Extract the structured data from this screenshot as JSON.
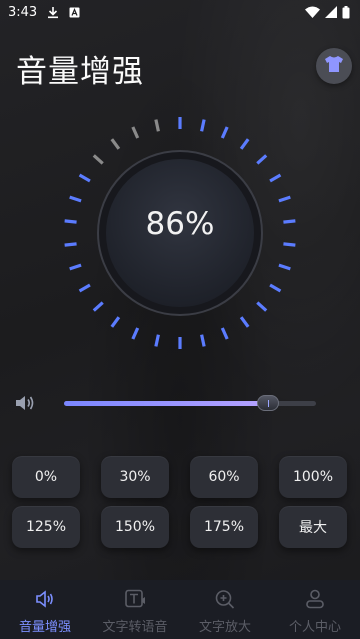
{
  "status_bar": {
    "time": "3:43"
  },
  "header": {
    "title": "音量增强"
  },
  "dial": {
    "percent_text": "86%",
    "level": 0.86,
    "tick_count": 30,
    "accent": "#5b7cff",
    "inactive_tick": "#8a8a8a"
  },
  "volume": {
    "level": 0.81,
    "icon": "speaker-icon"
  },
  "presets": [
    "0%",
    "30%",
    "60%",
    "100%",
    "125%",
    "150%",
    "175%",
    "最大"
  ],
  "nav": {
    "items": [
      {
        "label": "音量增强",
        "icon": "speaker-boost-icon",
        "active": true
      },
      {
        "label": "文字转语音",
        "icon": "text-to-speech-icon",
        "active": false
      },
      {
        "label": "文字放大",
        "icon": "zoom-icon",
        "active": false
      },
      {
        "label": "个人中心",
        "icon": "profile-icon",
        "active": false
      }
    ]
  },
  "colors": {
    "accent": "#7c8fff",
    "background": "#1f1f21",
    "button": "#2d2f36"
  }
}
